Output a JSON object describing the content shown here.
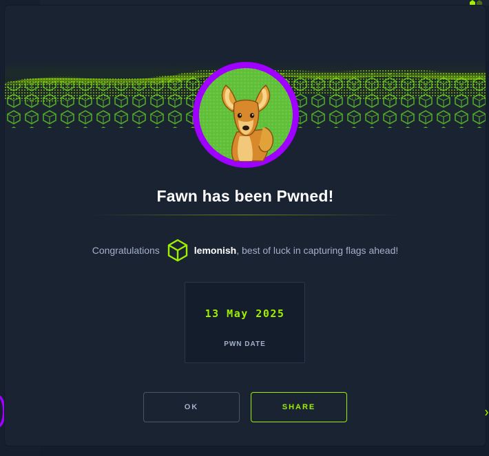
{
  "dialog": {
    "title": "Fawn has been Pwned!",
    "congrats_prefix": "Congratulations",
    "username": "lemonish",
    "congrats_suffix": ", best of luck in capturing flags ahead!",
    "pwn_date": "13 May 2025",
    "pwn_date_label": "PWN DATE",
    "ok_label": "OK",
    "share_label": "SHARE"
  },
  "icons": {
    "avatar": "fawn-avatar-icon",
    "user_badge": "htb-cube-icon",
    "banner": "green-hex-wave-banner"
  },
  "colors": {
    "background": "#141d2b",
    "modal": "#1a2332",
    "accent_green": "#9fef00",
    "avatar_ring": "#9f00ff",
    "text_muted": "#a4b1cd",
    "text_white": "#ffffff"
  }
}
